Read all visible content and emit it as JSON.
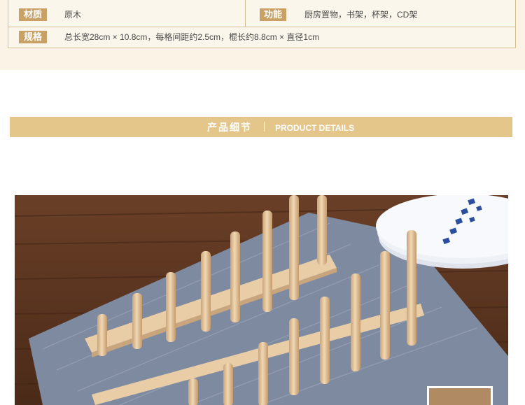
{
  "specs": {
    "material": {
      "label": "材质",
      "value": "原木"
    },
    "function": {
      "label": "功能",
      "value": "厨房置物，书架，杯架，CD架"
    },
    "size": {
      "label": "规格",
      "value": "总长宽28cm × 10.8cm，每格间距约2.5cm，棍长约8.8cm × 直径1cm"
    }
  },
  "section": {
    "title_cn": "产品细节",
    "title_en": "PRODUCT DETAILS"
  },
  "photo": {
    "subject": "wooden-plate-rack",
    "colors": {
      "table": "#5a3420",
      "cloth": "#7f8ba0",
      "wood": "#e6c9a0",
      "plate": "#f4f6fa",
      "plate_pattern": "#2b4f9e"
    }
  }
}
